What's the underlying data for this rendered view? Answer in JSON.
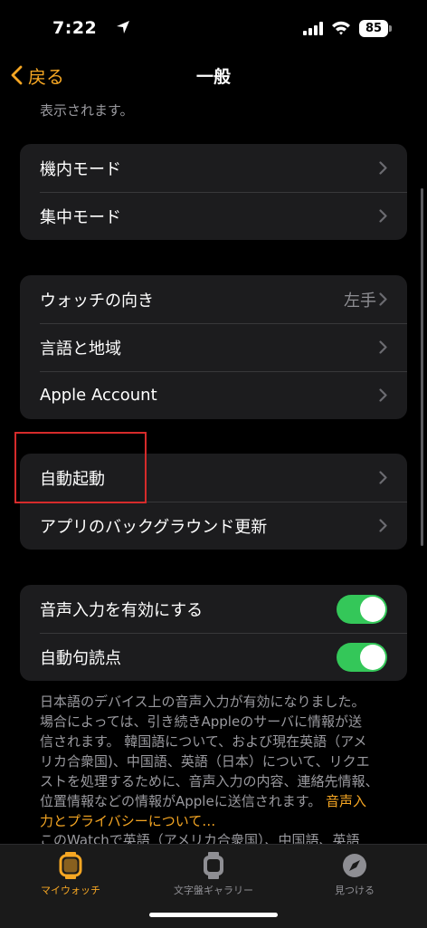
{
  "status_bar": {
    "time": "7:22",
    "battery": "85"
  },
  "nav": {
    "back_label": "戻る",
    "title": "一般"
  },
  "top_footnote": "表示されます。",
  "group1": [
    {
      "label": "機内モード"
    },
    {
      "label": "集中モード"
    }
  ],
  "group2": [
    {
      "label": "ウォッチの向き",
      "value": "左手"
    },
    {
      "label": "言語と地域"
    },
    {
      "label": "Apple Account"
    }
  ],
  "group3": [
    {
      "label": "自動起動"
    },
    {
      "label": "アプリのバックグラウンド更新"
    }
  ],
  "group4": [
    {
      "label": "音声入力を有効にする",
      "on": true
    },
    {
      "label": "自動句読点",
      "on": true
    }
  ],
  "footnote": {
    "line1": "日本語のデバイス上の音声入力が有効になりました。",
    "line2": "場合によっては、引き続きAppleのサーバに情報が送",
    "line3": "信されます。 韓国語について、および現在英語（アメ",
    "line4": "リカ合衆国)、中国語、英語（日本）について、リクエ",
    "line5": "ストを処理するために、音声入力の内容、連絡先情報、",
    "line6": "位置情報などの情報がAppleに送信されます。",
    "link1": "音声入",
    "link2": "力とプライバシーについて…"
  },
  "footnote2": "このWatchで英語（アメリカ合衆国）、中国語、英語",
  "tabs": [
    {
      "label": "マイウォッチ",
      "active": true
    },
    {
      "label": "文字盤ギャラリー"
    },
    {
      "label": "見つける"
    }
  ],
  "colors": {
    "accent": "#f5a623",
    "toggle_on": "#34c759",
    "highlight": "#d62b2b"
  }
}
